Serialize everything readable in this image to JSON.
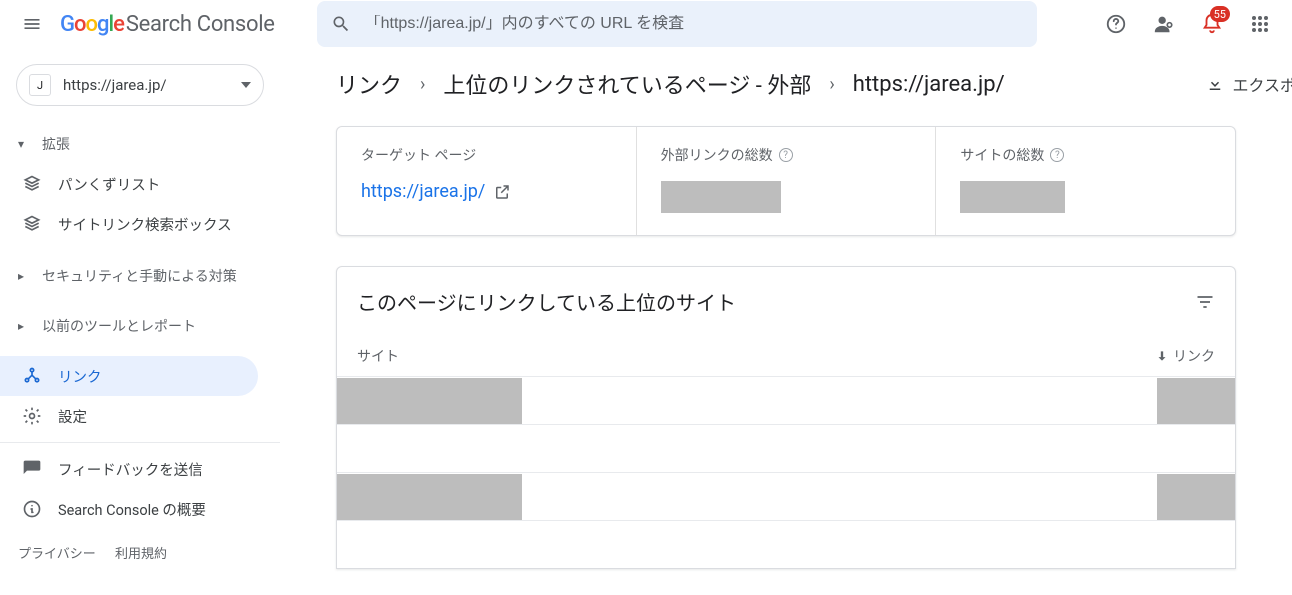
{
  "header": {
    "logo_text": "Search Console",
    "search_placeholder": "「https://jarea.jp/」内のすべての URL を検査",
    "notification_count": "55"
  },
  "sidebar": {
    "property": "https://jarea.jp/",
    "expand_label": "拡張",
    "nav_breadcrumbs": "パンくずリスト",
    "nav_sitelinks": "サイトリンク検索ボックス",
    "nav_security": "セキュリティと手動による対策",
    "nav_legacy": "以前のツールとレポート",
    "nav_links": "リンク",
    "nav_settings": "設定",
    "nav_feedback": "フィードバックを送信",
    "nav_about": "Search Console の概要",
    "footer_privacy": "プライバシー",
    "footer_terms": "利用規約"
  },
  "breadcrumb": {
    "c1": "リンク",
    "c2": "上位のリンクされているページ - 外部",
    "c3": "https://jarea.jp/",
    "export": "エクスポ"
  },
  "cards": {
    "target_label": "ターゲット ページ",
    "target_value": "https://jarea.jp/",
    "external_label": "外部リンクの総数",
    "sites_label": "サイトの総数"
  },
  "table": {
    "title": "このページにリンクしている上位のサイト",
    "col_site": "サイト",
    "col_links": "リンク"
  }
}
